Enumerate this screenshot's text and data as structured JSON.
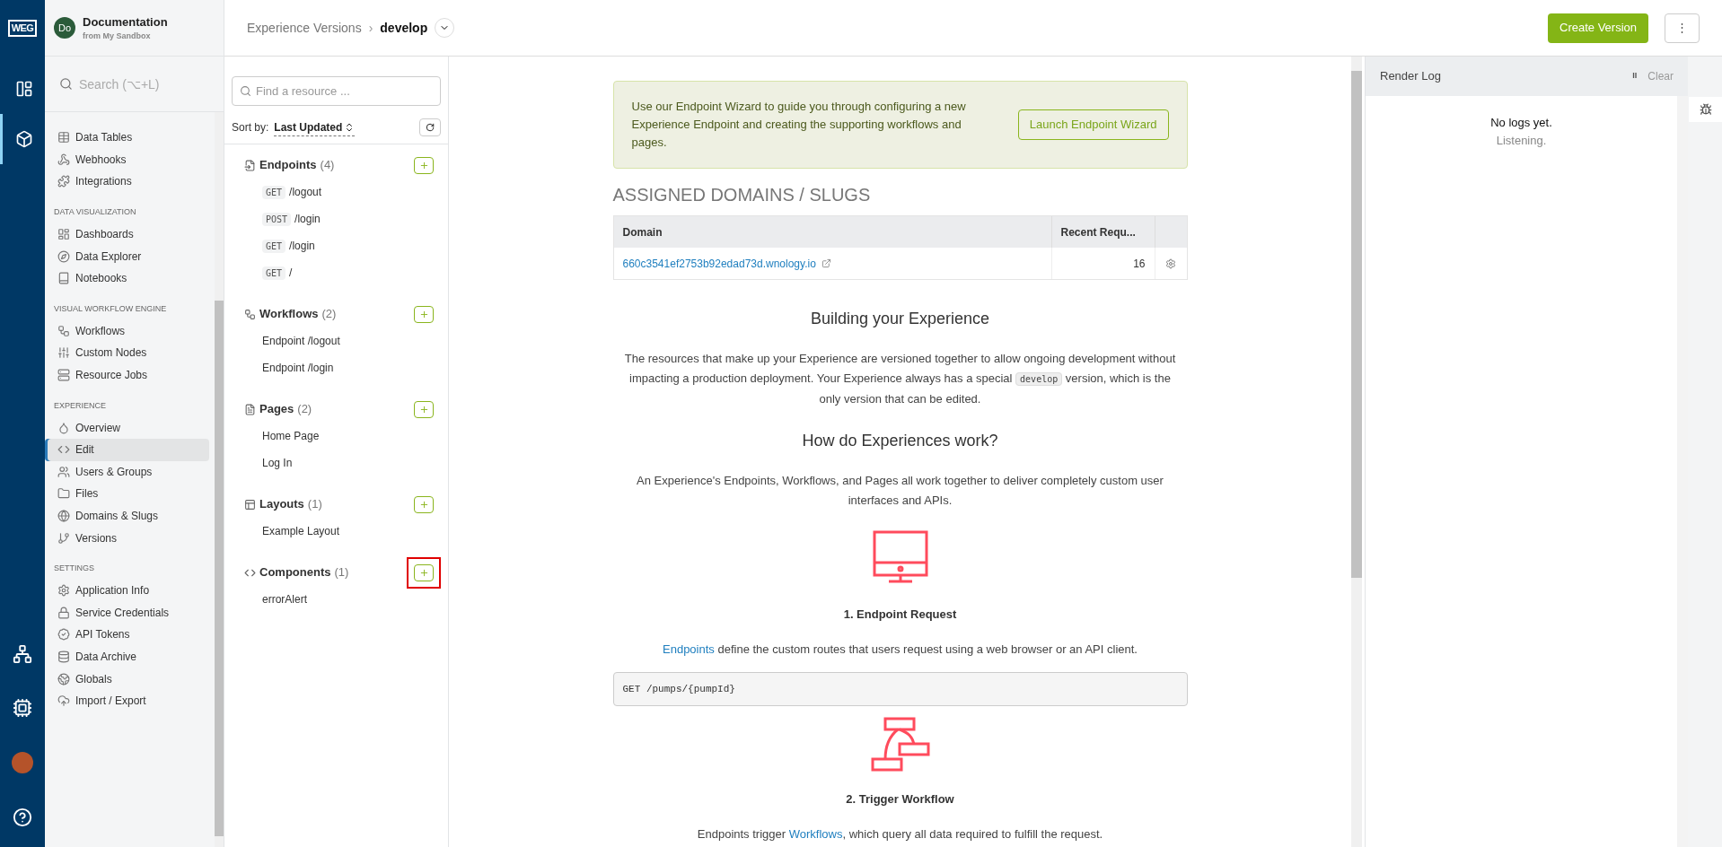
{
  "rail": {
    "logo": "WEG",
    "top": [
      {
        "kind": "dashboard",
        "selected": false
      },
      {
        "kind": "cube",
        "selected": true
      }
    ]
  },
  "app": {
    "avatar": "Do",
    "title": "Documentation",
    "subtitle": "from My Sandbox"
  },
  "search": {
    "placeholder": "Search (⌥+L)"
  },
  "sidebar": {
    "sections": [
      {
        "items": [
          {
            "label": "Data Tables",
            "selected": false
          },
          {
            "label": "Webhooks",
            "selected": false
          },
          {
            "label": "Integrations",
            "selected": false
          }
        ]
      },
      {
        "title": "DATA VISUALIZATION",
        "items": [
          {
            "label": "Dashboards",
            "selected": false
          },
          {
            "label": "Data Explorer",
            "selected": false
          },
          {
            "label": "Notebooks",
            "selected": false
          }
        ]
      },
      {
        "title": "VISUAL WORKFLOW ENGINE",
        "items": [
          {
            "label": "Workflows",
            "selected": false
          },
          {
            "label": "Custom Nodes",
            "selected": false
          },
          {
            "label": "Resource Jobs",
            "selected": false
          }
        ]
      },
      {
        "title": "EXPERIENCE",
        "items": [
          {
            "label": "Overview",
            "selected": false
          },
          {
            "label": "Edit",
            "selected": true
          },
          {
            "label": "Users & Groups",
            "selected": false
          },
          {
            "label": "Files",
            "selected": false
          },
          {
            "label": "Domains & Slugs",
            "selected": false
          },
          {
            "label": "Versions",
            "selected": false
          }
        ]
      },
      {
        "title": "SETTINGS",
        "items": [
          {
            "label": "Application Info",
            "selected": false
          },
          {
            "label": "Service Credentials",
            "selected": false
          },
          {
            "label": "API Tokens",
            "selected": false
          },
          {
            "label": "Data Archive",
            "selected": false
          },
          {
            "label": "Globals",
            "selected": false
          },
          {
            "label": "Import / Export",
            "selected": false
          }
        ]
      }
    ]
  },
  "breadcrumb": {
    "parent": "Experience Versions",
    "separator": "›",
    "current": "develop"
  },
  "toolbar": {
    "primary": "Create Version",
    "more": "⋮"
  },
  "resources": {
    "search_placeholder": "Find a resource ...",
    "sort_label": "Sort by:",
    "sort_value": "Last Updated",
    "sections": [
      {
        "title": "Endpoints",
        "count": "(4)",
        "highlighted": false,
        "items": [
          {
            "method": "GET",
            "label": "/logout"
          },
          {
            "method": "POST",
            "label": "/login"
          },
          {
            "method": "GET",
            "label": "/login"
          },
          {
            "method": "GET",
            "label": "/"
          }
        ]
      },
      {
        "title": "Workflows",
        "count": "(2)",
        "highlighted": false,
        "items": [
          {
            "label": "Endpoint /logout"
          },
          {
            "label": "Endpoint /login"
          }
        ]
      },
      {
        "title": "Pages",
        "count": "(2)",
        "highlighted": false,
        "items": [
          {
            "label": "Home Page"
          },
          {
            "label": "Log In"
          }
        ]
      },
      {
        "title": "Layouts",
        "count": "(1)",
        "highlighted": false,
        "items": [
          {
            "label": "Example Layout"
          }
        ]
      },
      {
        "title": "Components",
        "count": "(1)",
        "highlighted": true,
        "items": [
          {
            "label": "errorAlert"
          }
        ]
      }
    ]
  },
  "banner": {
    "text": "Use our Endpoint Wizard to guide you through configuring a new Experience Endpoint and creating the supporting workflows and pages.",
    "button": "Launch Endpoint Wizard"
  },
  "domains": {
    "heading": "ASSIGNED DOMAINS / SLUGS",
    "columns": [
      "Domain",
      "Recent Requ..."
    ],
    "rows": [
      {
        "domain": "660c3541ef2753b92edad73d.wnology.io",
        "requests": "16"
      }
    ]
  },
  "docs": [
    {
      "kind": "heading",
      "text": "Building your Experience"
    },
    {
      "kind": "paragraph",
      "parts": [
        {
          "kind": "text",
          "text": "The resources that make up your Experience are versioned together to allow ongoing development without impacting a production deployment. Your Experience always has a special "
        },
        {
          "kind": "code",
          "text": "develop"
        },
        {
          "kind": "text",
          "text": " version, which is the only version that can be edited."
        }
      ]
    },
    {
      "kind": "heading",
      "text": "How do Experiences work?"
    },
    {
      "kind": "paragraph",
      "parts": [
        {
          "kind": "text",
          "text": "An Experience's Endpoints, Workflows, and Pages all work together to deliver completely custom user interfaces and APIs."
        }
      ]
    },
    {
      "kind": "monitor"
    },
    {
      "kind": "step",
      "text": "1. Endpoint Request"
    },
    {
      "kind": "paragraph",
      "parts": [
        {
          "kind": "link",
          "text": "Endpoints"
        },
        {
          "kind": "text",
          "text": " define the custom routes that users request using a web browser or an API client."
        }
      ]
    },
    {
      "kind": "code",
      "text": "GET /pumps/{pumpId}"
    },
    {
      "kind": "workflow"
    },
    {
      "kind": "step",
      "text": "2. Trigger Workflow"
    },
    {
      "kind": "paragraph",
      "parts": [
        {
          "kind": "text",
          "text": "Endpoints trigger "
        },
        {
          "kind": "link",
          "text": "Workflows"
        },
        {
          "kind": "text",
          "text": ", which query all data required to fulfill the request."
        }
      ]
    }
  ],
  "render_log": {
    "title": "Render Log",
    "pause": "II",
    "clear": "Clear",
    "empty": "No logs yet.",
    "status": "Listening."
  }
}
